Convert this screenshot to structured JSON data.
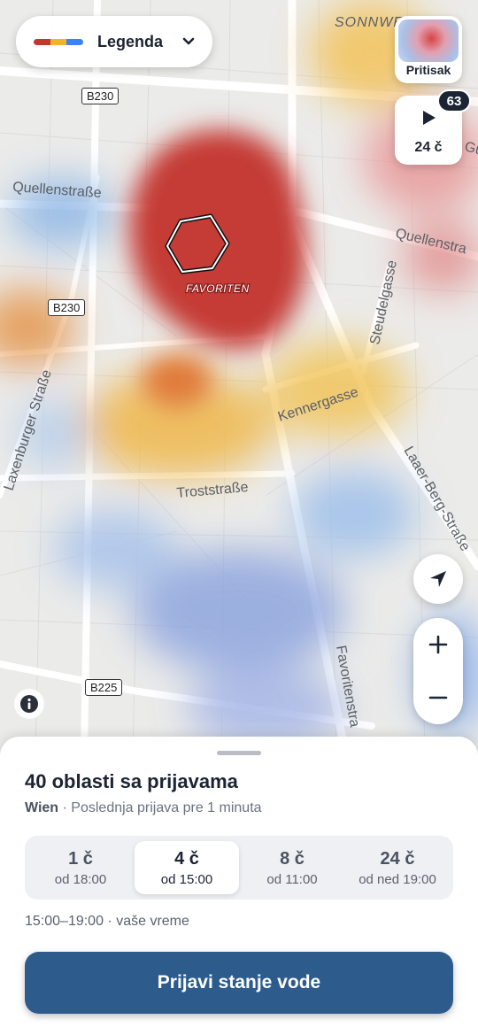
{
  "legend": {
    "label": "Legenda",
    "colors": [
      "#c0392b",
      "#f0b429",
      "#3b82f6"
    ]
  },
  "map": {
    "place_labels": [
      "SONNWENI",
      "Quellenstraße",
      "Quellenstra",
      "FAVORITEN",
      "Steudelgasse",
      "Kennergasse",
      "Laxenburger Straße",
      "Troststraße",
      "Laaer-Berg-Straße",
      "Favoritenstra",
      "Gu"
    ],
    "shields": [
      "B230",
      "B230",
      "B225"
    ]
  },
  "pressure": {
    "label": "Pritisak"
  },
  "playback": {
    "label": "24 č",
    "badge": "63"
  },
  "sheet": {
    "title": "40 oblasti sa prijavama",
    "city": "Wien",
    "subtitle": " · Poslednja prijava pre 1 minuta",
    "segments": [
      {
        "value": "1 č",
        "sub": "od 18:00"
      },
      {
        "value": "4 č",
        "sub": "od 15:00"
      },
      {
        "value": "8 č",
        "sub": "od 11:00"
      },
      {
        "value": "24 č",
        "sub": "od ned 19:00"
      }
    ],
    "selected_segment": 1,
    "time_note": "15:00–19:00 · vaše vreme",
    "report_button": "Prijavi stanje vode"
  }
}
